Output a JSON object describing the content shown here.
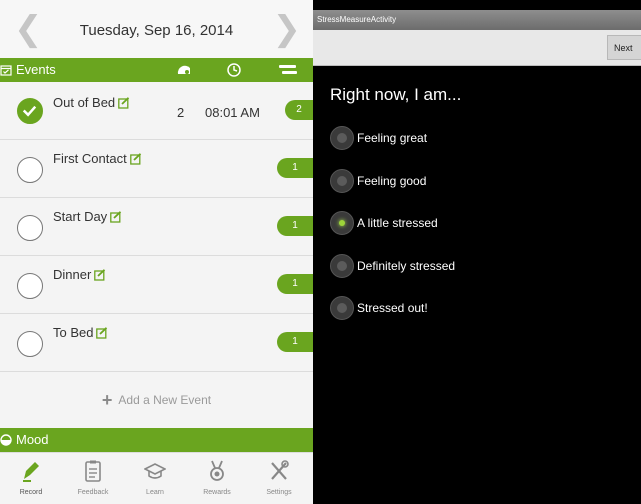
{
  "left": {
    "date": "Tuesday, Sep 16, 2014",
    "events_header": {
      "label": "Events"
    },
    "events": [
      {
        "name": "Out of Bed",
        "done": true,
        "count": "2",
        "time": "08:01 AM",
        "badge": "2"
      },
      {
        "name": "First Contact",
        "done": false,
        "badge": "1"
      },
      {
        "name": "Start Day",
        "done": false,
        "badge": "1"
      },
      {
        "name": "Dinner",
        "done": false,
        "badge": "1"
      },
      {
        "name": "To Bed",
        "done": false,
        "badge": "1"
      }
    ],
    "add_event": "Add a New Event",
    "mood_label": "Mood",
    "tabs": [
      {
        "label": "Record",
        "icon": "pencil-icon",
        "active": true
      },
      {
        "label": "Feedback",
        "icon": "clipboard-icon"
      },
      {
        "label": "Learn",
        "icon": "graduation-cap-icon"
      },
      {
        "label": "Rewards",
        "icon": "medal-icon"
      },
      {
        "label": "Settings",
        "icon": "tools-icon"
      }
    ],
    "accent_color": "#6aa51f"
  },
  "right": {
    "activity_title": "StressMeasureActivity",
    "next_label": "Next",
    "question": "Right now, I am...",
    "options": [
      {
        "label": "Feeling great",
        "selected": false
      },
      {
        "label": "Feeling good",
        "selected": false
      },
      {
        "label": "A little stressed",
        "selected": true
      },
      {
        "label": "Definitely stressed",
        "selected": false
      },
      {
        "label": "Stressed out!",
        "selected": false
      }
    ]
  }
}
